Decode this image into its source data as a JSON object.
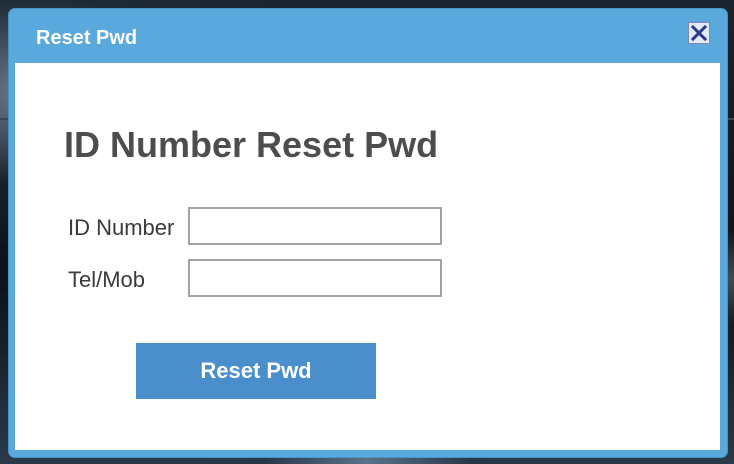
{
  "dialog": {
    "title": "Reset Pwd",
    "close_icon": "close-icon"
  },
  "form": {
    "heading": "ID Number Reset Pwd",
    "id_number": {
      "label": "ID Number",
      "value": "",
      "placeholder": ""
    },
    "tel_mob": {
      "label": "Tel/Mob",
      "value": "",
      "placeholder": ""
    },
    "submit_label": "Reset Pwd"
  },
  "colors": {
    "header_bg": "#5aa9dc",
    "button_bg": "#4a8ecb",
    "heading_text": "#4d4d4d"
  }
}
